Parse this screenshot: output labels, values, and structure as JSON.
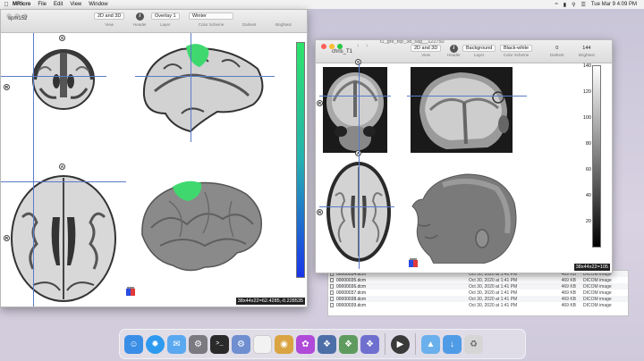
{
  "menubar": {
    "app_name": "MRIcro",
    "menus": [
      "File",
      "Edit",
      "View",
      "Window"
    ],
    "clock": "Tue Mar 9  4:09 PM"
  },
  "window_left": {
    "title": "spm152",
    "controls": [
      {
        "value": "2D and 3D",
        "caption": "View"
      },
      {
        "value": "",
        "caption": "Header"
      },
      {
        "value": "Overlay 1",
        "caption": "Layer"
      },
      {
        "value": "Winter",
        "caption": "Color Scheme"
      },
      {
        "value": "",
        "caption": "Darkest"
      },
      {
        "value": "",
        "caption": "Brightest"
      }
    ],
    "orient_labels": {
      "coronal_top": "S",
      "coronal_left": "R",
      "axial_top": "A",
      "axial_left": "R"
    },
    "readout": "38x44x22=62.4285,-0.228535",
    "colors": {
      "colorbar_top": "#2fe36a",
      "colorbar_bottom": "#1a35e8",
      "overlay": "#3fd86f"
    }
  },
  "window_right": {
    "title": "chris_T1",
    "tab_title": "t1_gre_fsp_3d_sag__122750",
    "controls": [
      {
        "value": "2D and 3D",
        "caption": "View"
      },
      {
        "value": "",
        "caption": "Header"
      },
      {
        "value": "Background",
        "caption": "Layer"
      },
      {
        "value": "Black-white",
        "caption": "Color Scheme"
      },
      {
        "value": "0",
        "caption": "Darkest"
      },
      {
        "value": "144",
        "caption": "Brightest"
      }
    ],
    "orient_labels": {
      "coronal_top": "S",
      "coronal_left": "R",
      "coronal_bottom": "A",
      "axial_left": "R"
    },
    "colorbar_ticks": [
      "140",
      "120",
      "100",
      "80",
      "60",
      "40",
      "20"
    ],
    "readout": "38x44x22=105"
  },
  "finder": {
    "rows": [
      {
        "name": "00000034.dcm",
        "date": "Oct 30, 2020 at 1:41 PM",
        "size": "469 KB",
        "kind": "DICOM image"
      },
      {
        "name": "00000035.dcm",
        "date": "Oct 30, 2020 at 1:41 PM",
        "size": "469 KB",
        "kind": "DICOM image"
      },
      {
        "name": "00000036.dcm",
        "date": "Oct 30, 2020 at 1:41 PM",
        "size": "469 KB",
        "kind": "DICOM image"
      },
      {
        "name": "00000037.dcm",
        "date": "Oct 30, 2020 at 1:41 PM",
        "size": "469 KB",
        "kind": "DICOM image"
      },
      {
        "name": "00000038.dcm",
        "date": "Oct 30, 2020 at 1:41 PM",
        "size": "469 KB",
        "kind": "DICOM image"
      },
      {
        "name": "00000039.dcm",
        "date": "Oct 30, 2020 at 1:41 PM",
        "size": "469 KB",
        "kind": "DICOM image"
      }
    ]
  },
  "dock": {
    "icons": [
      {
        "name": "finder-icon",
        "color": "#3a8ee6"
      },
      {
        "name": "safari-icon",
        "color": "#2d9af0"
      },
      {
        "name": "mail-icon",
        "color": "#5aa8f0"
      },
      {
        "name": "system-preferences-icon",
        "color": "#7a7a80"
      },
      {
        "name": "terminal-icon",
        "color": "#2a2a2a"
      },
      {
        "name": "gear-app-icon",
        "color": "#6f8fd0"
      },
      {
        "name": "blank-app-icon",
        "color": "#f2f2f2"
      },
      {
        "name": "palette-icon",
        "color": "#d9a441"
      },
      {
        "name": "flower-icon",
        "color": "#b04ad8"
      },
      {
        "name": "brain-app-icon",
        "color": "#4d6fa8"
      },
      {
        "name": "brain-green-icon",
        "color": "#5f9b5f"
      },
      {
        "name": "brain-blue-icon",
        "color": "#6f6fcf"
      },
      {
        "name": "quicktime-icon",
        "color": "#3a3a3a"
      },
      {
        "name": "applications-folder-icon",
        "color": "#6ab0ec"
      },
      {
        "name": "downloads-folder-icon",
        "color": "#4f9be6"
      },
      {
        "name": "trash-icon",
        "color": "#d6d6d6"
      }
    ]
  }
}
